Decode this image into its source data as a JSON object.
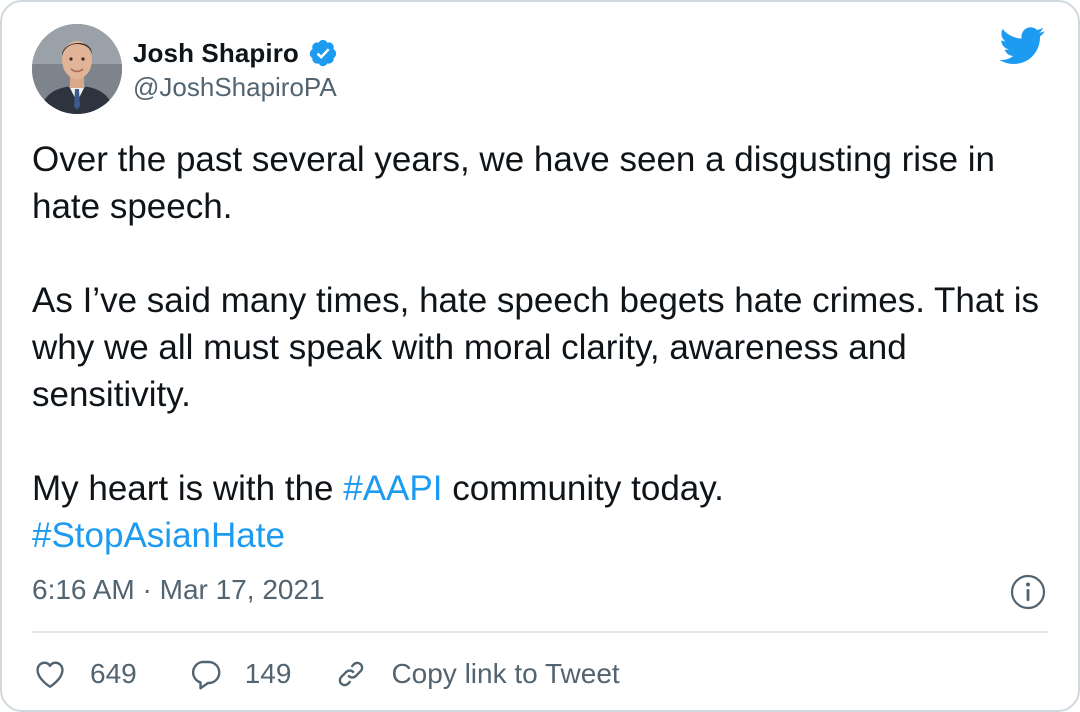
{
  "author": {
    "name": "Josh Shapiro",
    "handle": "@JoshShapiroPA",
    "verified": true
  },
  "tweet": {
    "line1": "Over the past several years, we have seen a disgusting rise in hate speech.",
    "para2": "As I’ve said many times, hate speech begets hate crimes. That is why we all must speak with moral clarity, awareness and sensitivity.",
    "para3_before": "My heart is with the ",
    "hashtag1": "#AAPI",
    "para3_after": " community today.",
    "hashtag2": "#StopAsianHate"
  },
  "meta": {
    "timestamp": "6:16 AM · Mar 17, 2021"
  },
  "actions": {
    "likes": "649",
    "replies": "149",
    "copy_link": "Copy link to Tweet"
  },
  "icons": {
    "brand": "twitter-bird-icon",
    "verified": "verified-badge-icon",
    "info": "info-icon",
    "like": "heart-icon",
    "reply": "reply-bubble-icon",
    "link": "link-icon"
  },
  "colors": {
    "accent": "#1d9bf0",
    "text": "#0f1419",
    "secondary": "#536471",
    "border": "#cfd9de"
  }
}
